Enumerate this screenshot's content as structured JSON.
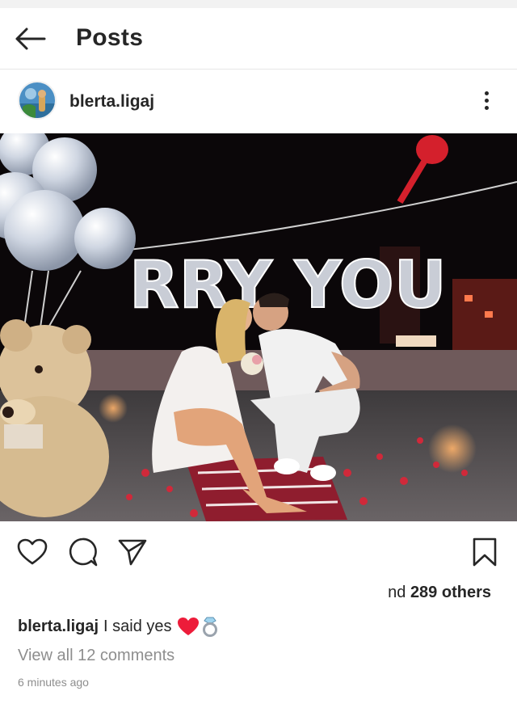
{
  "header": {
    "title": "Posts",
    "back_icon": "arrow-left-icon"
  },
  "post": {
    "username": "blerta.ligaj",
    "more_icon": "more-vertical-icon",
    "photo_banner_text": "RRY YOU"
  },
  "actions": {
    "icons": [
      "heart-icon",
      "comment-icon",
      "share-icon",
      "bookmark-icon"
    ]
  },
  "likes": {
    "prefix": "nd",
    "count": "289 others"
  },
  "caption": {
    "username": "blerta.ligaj",
    "text": "I said yes",
    "emoji": [
      "heart",
      "ring"
    ]
  },
  "comments": {
    "view_all": "View all 12 comments"
  },
  "timestamp": "6 minutes ago",
  "colors": {
    "text": "#262626",
    "muted": "#8e8e8e",
    "heart": "#ed1c3a"
  }
}
